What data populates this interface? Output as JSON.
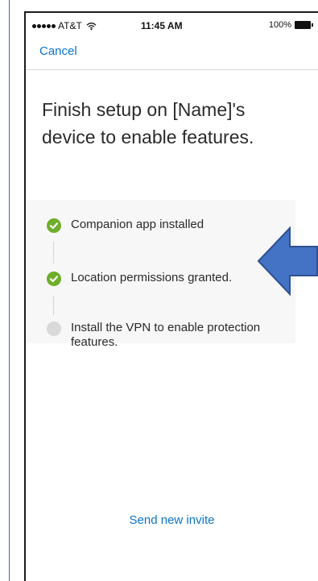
{
  "status_bar": {
    "carrier": "AT&T",
    "time": "11:45 AM",
    "battery": "100%"
  },
  "nav": {
    "cancel_label": "Cancel"
  },
  "content": {
    "title": "Finish setup on [Name]'s device to enable features."
  },
  "steps": [
    {
      "label": "Companion app installed",
      "status": "complete"
    },
    {
      "label": "Location permissions granted.",
      "status": "complete"
    },
    {
      "label": "Install the VPN to enable protection features.",
      "status": "pending"
    }
  ],
  "actions": {
    "send_invite_label": "Send new invite"
  },
  "colors": {
    "link_blue": "#0b73c7",
    "success_green": "#6fae2a",
    "pending_gray": "#d9d9d9",
    "annotation_blue": "#4472c4"
  },
  "icons": {
    "signal": "signal-icon",
    "wifi": "wifi-icon",
    "battery": "battery-icon",
    "check": "check-circle-icon",
    "pending": "pending-circle-icon",
    "annotation": "left-arrow-icon"
  }
}
